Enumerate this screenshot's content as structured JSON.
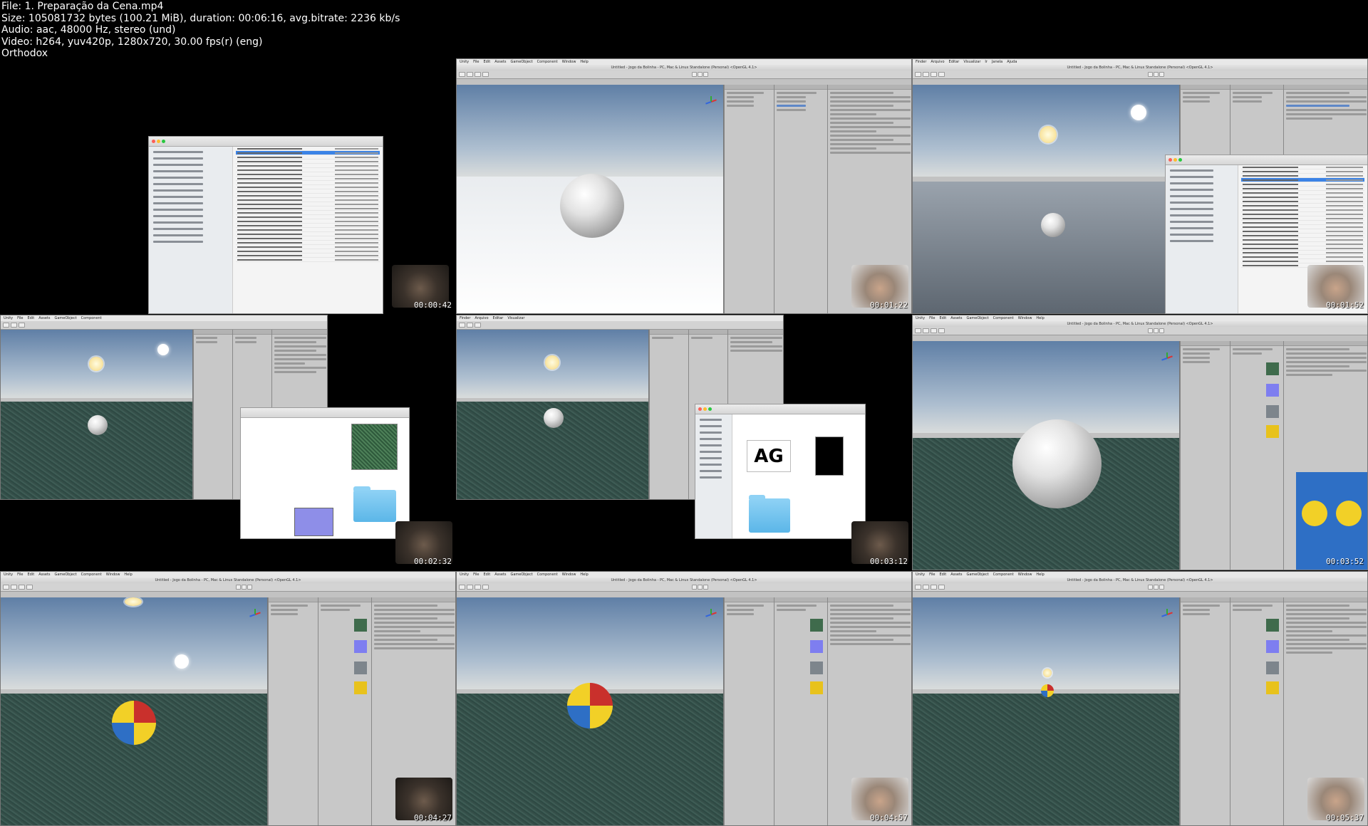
{
  "file_info": {
    "line1": "File: 1. Preparação da Cena.mp4",
    "line2": "Size: 105081732 bytes (100.21 MiB), duration: 00:06:16, avg.bitrate: 2236 kb/s",
    "line3": "Audio: aac, 48000 Hz, stereo (und)",
    "line4": "Video: h264, yuv420p, 1280x720, 30.00 fps(r) (eng)",
    "line5": "Orthodox"
  },
  "unity_menu": [
    "Unity",
    "File",
    "Edit",
    "Assets",
    "GameObject",
    "Component",
    "Window",
    "Help"
  ],
  "unity_title": "Untitled - Jogo da Bolinha - PC, Mac & Linux Standalone (Personal) <OpenGL 4.1>",
  "finder_menu": [
    "Finder",
    "Arquivo",
    "Editar",
    "Visualizar",
    "Ir",
    "Janela",
    "Ajuda"
  ],
  "thumb_text": "AG",
  "frames": [
    {
      "timestamp": "00:00:42"
    },
    {
      "timestamp": "00:01:22"
    },
    {
      "timestamp": "00:01:52"
    },
    {
      "timestamp": "00:02:32"
    },
    {
      "timestamp": "00:03:12"
    },
    {
      "timestamp": "00:03:52"
    },
    {
      "timestamp": "00:04:27"
    },
    {
      "timestamp": "00:04:57"
    },
    {
      "timestamp": "00:05:37"
    }
  ],
  "colors": {
    "background": "#000000",
    "finder_selection": "#3b83e6",
    "unity_chrome": "#c2c2c2"
  }
}
